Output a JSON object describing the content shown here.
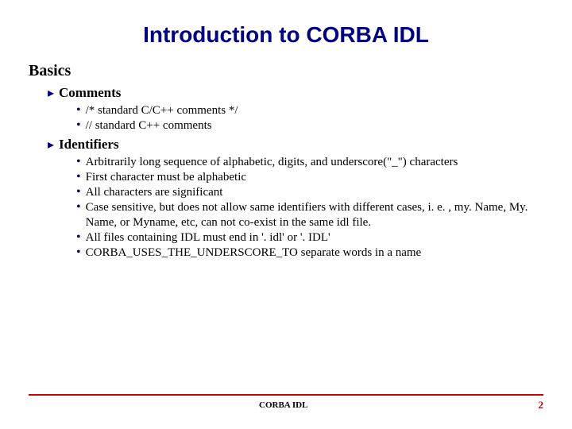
{
  "title": "Introduction to CORBA IDL",
  "section": "Basics",
  "groups": [
    {
      "heading": "Comments",
      "items": [
        "/* standard C/C++ comments */",
        "// standard C++ comments"
      ]
    },
    {
      "heading": "Identifiers",
      "items": [
        "Arbitrarily long sequence of alphabetic, digits, and underscore(\"_\") characters",
        "First character must be alphabetic",
        "All characters are significant",
        "Case sensitive, but does not allow same identifiers with different cases, i. e. , my. Name, My. Name, or Myname, etc, can not co-exist in the same idl file.",
        "All files containing IDL must end in '. idl' or '. IDL'",
        "CORBA_USES_THE_UNDERSCORE_TO separate words in a name"
      ]
    }
  ],
  "footer": {
    "label": "CORBA IDL",
    "page": "2"
  },
  "glyphs": {
    "lvl1": "▸",
    "lvl2": "•"
  }
}
